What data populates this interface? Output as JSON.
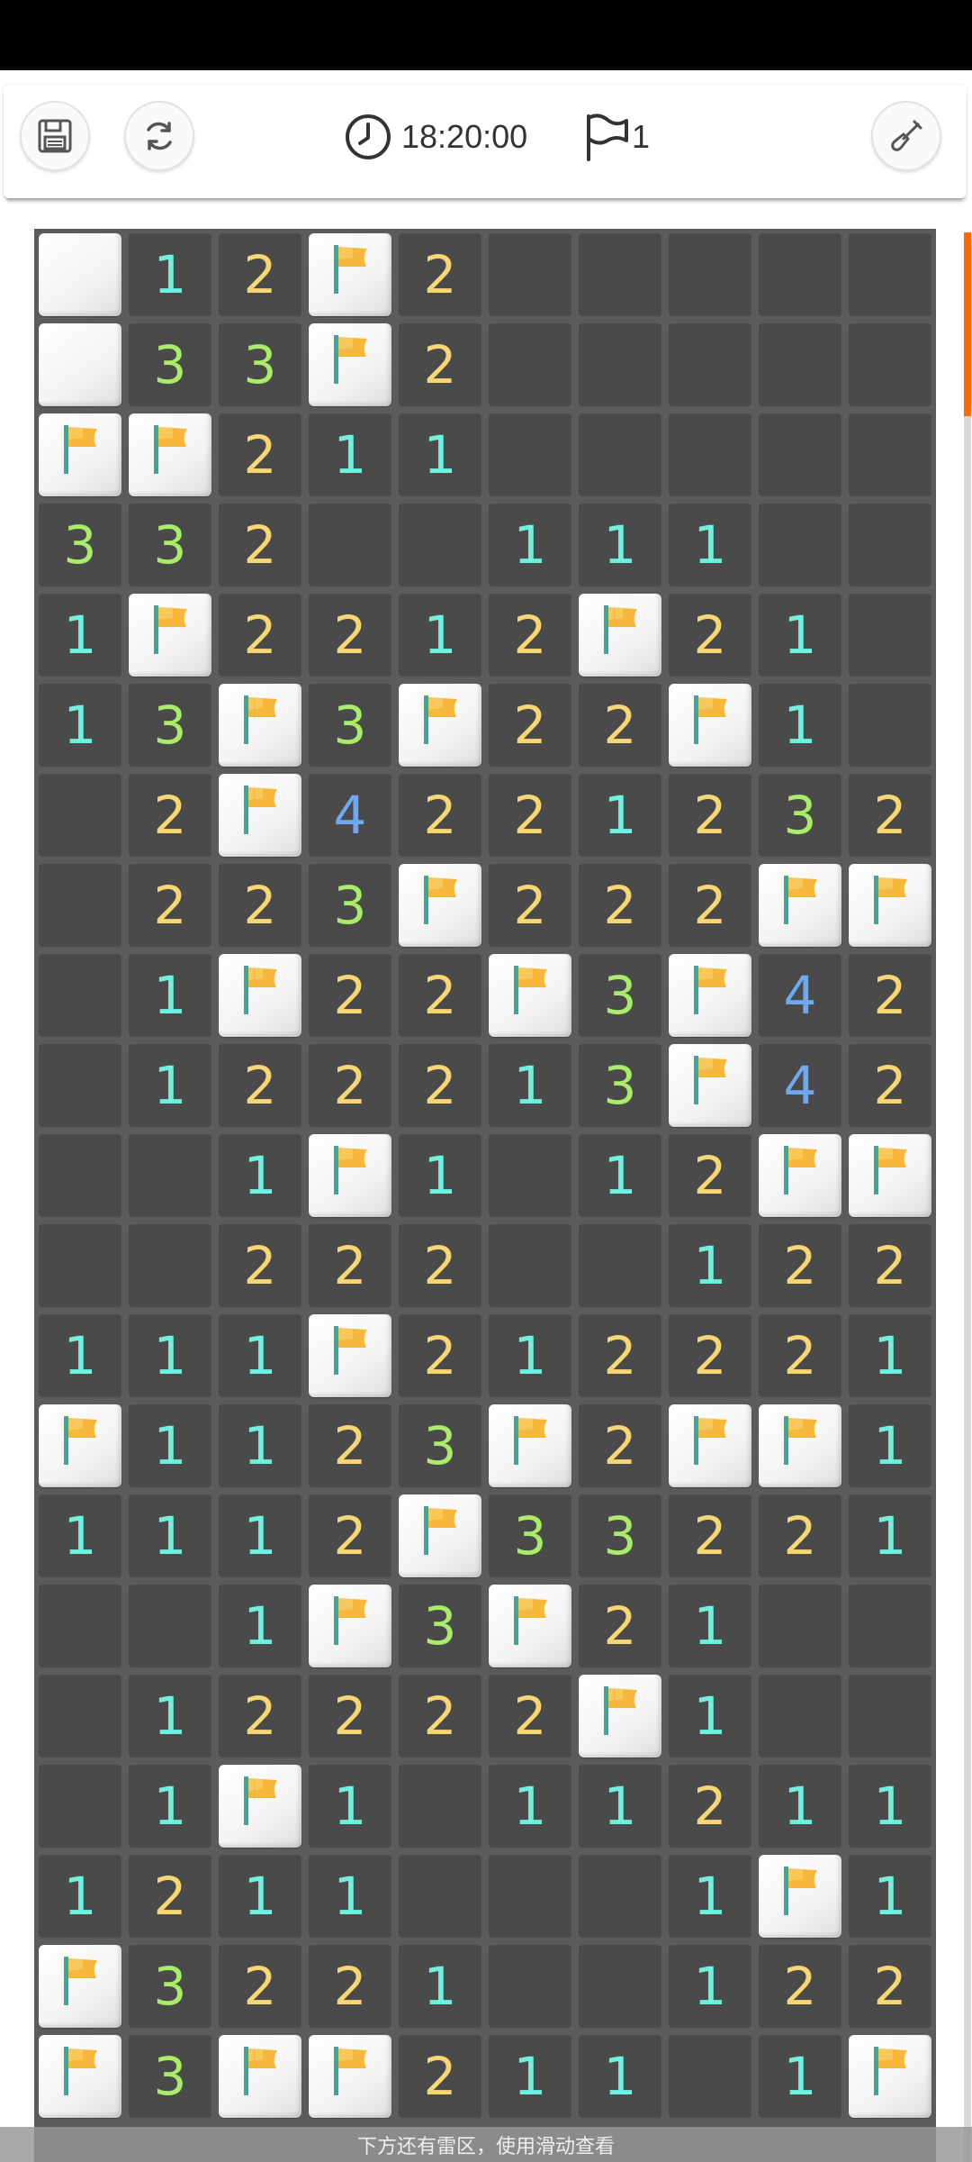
{
  "toolbar": {
    "save_icon": "save-icon",
    "restart_icon": "refresh-icon",
    "timer_icon": "clock-icon",
    "time": "18:20:00",
    "flag_icon": "flag-icon",
    "flag_count": "1",
    "tool_icon": "shovel-icon"
  },
  "board": {
    "columns": 10,
    "rows": [
      [
        "E",
        "1",
        "2",
        "F",
        "2",
        "H",
        "H",
        "H",
        "H",
        "H"
      ],
      [
        "E",
        "3",
        "3",
        "F",
        "2",
        "H",
        "H",
        "H",
        "H",
        "H"
      ],
      [
        "F",
        "F",
        "2",
        "1",
        "1",
        "H",
        "H",
        "H",
        "H",
        "H"
      ],
      [
        "3",
        "3",
        "2",
        "",
        "",
        "1",
        "1",
        "1",
        "H",
        "H"
      ],
      [
        "1",
        "F",
        "2",
        "2",
        "1",
        "2",
        "F",
        "2",
        "1",
        "H"
      ],
      [
        "1",
        "3",
        "F",
        "3",
        "F",
        "2",
        "2",
        "F",
        "1",
        "H"
      ],
      [
        "",
        "2",
        "F",
        "4",
        "2",
        "2",
        "1",
        "2",
        "3",
        "2"
      ],
      [
        "",
        "2",
        "2",
        "3",
        "F",
        "2",
        "2",
        "2",
        "F",
        "F"
      ],
      [
        "",
        "1",
        "F",
        "2",
        "2",
        "F",
        "3",
        "F",
        "4",
        "2"
      ],
      [
        "",
        "1",
        "2",
        "2",
        "2",
        "1",
        "3",
        "F",
        "4",
        "2"
      ],
      [
        "",
        "",
        "1",
        "F",
        "1",
        "",
        "1",
        "2",
        "F",
        "F"
      ],
      [
        "",
        "",
        "2",
        "2",
        "2",
        "",
        "",
        "1",
        "2",
        "2"
      ],
      [
        "1",
        "1",
        "1",
        "F",
        "2",
        "1",
        "2",
        "2",
        "2",
        "1"
      ],
      [
        "F",
        "1",
        "1",
        "2",
        "3",
        "F",
        "2",
        "F",
        "F",
        "1"
      ],
      [
        "1",
        "1",
        "1",
        "2",
        "F",
        "3",
        "3",
        "2",
        "2",
        "1"
      ],
      [
        "",
        "",
        "1",
        "F",
        "3",
        "F",
        "2",
        "1",
        "",
        ""
      ],
      [
        "",
        "1",
        "2",
        "2",
        "2",
        "2",
        "F",
        "1",
        "",
        ""
      ],
      [
        "",
        "1",
        "F",
        "1",
        "",
        "1",
        "1",
        "2",
        "1",
        "1"
      ],
      [
        "1",
        "2",
        "1",
        "1",
        "",
        "",
        "",
        "1",
        "F",
        "1"
      ],
      [
        "F",
        "3",
        "2",
        "2",
        "1",
        "",
        "",
        "1",
        "2",
        "2"
      ],
      [
        "F",
        "3",
        "F",
        "F",
        "2",
        "1",
        "1",
        "",
        "1",
        "F"
      ]
    ]
  },
  "colors": {
    "number_1": "#6ef0dc",
    "number_2": "#f7d774",
    "number_3": "#a9ec6a",
    "number_4": "#6ea8f0",
    "board_bg": "#5b5b5b",
    "cell_revealed": "#4a4a4a",
    "scroll_accent": "#ff6a00"
  },
  "hint": "下方还有雷区，使用滑动查看"
}
